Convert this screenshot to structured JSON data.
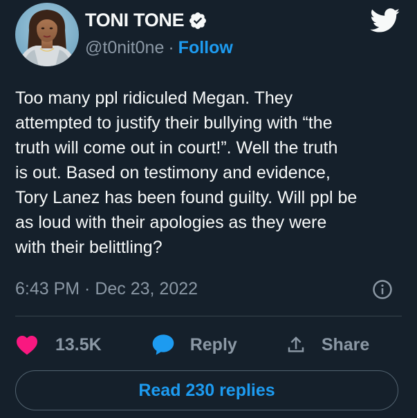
{
  "author": {
    "display_name": "TONI TONE",
    "handle": "@t0nit0ne",
    "follow_label": "Follow",
    "separator": "·"
  },
  "tweet": {
    "text": "Too many ppl ridiculed Megan. They\nattempted to justify their bullying with “the\ntruth will come out in court!”. Well the truth\nis out. Based on testimony and evidence,\nTory Lanez has been found guilty. Will ppl be\nas loud with their apologies as they were\nwith their belittling?",
    "timestamp": "6:43 PM · Dec 23, 2022"
  },
  "actions": {
    "likes": "13.5K",
    "reply_label": "Reply",
    "share_label": "Share"
  },
  "read_replies_label": "Read 230 replies",
  "colors": {
    "background": "#15202b",
    "accent": "#1d9bf0",
    "like": "#f91880",
    "muted": "#8b98a5",
    "text": "#f7f9f9"
  },
  "icons": [
    "avatar",
    "verified-badge-icon",
    "twitter-logo-icon",
    "info-icon",
    "heart-icon",
    "reply-bubble-icon",
    "share-icon"
  ]
}
